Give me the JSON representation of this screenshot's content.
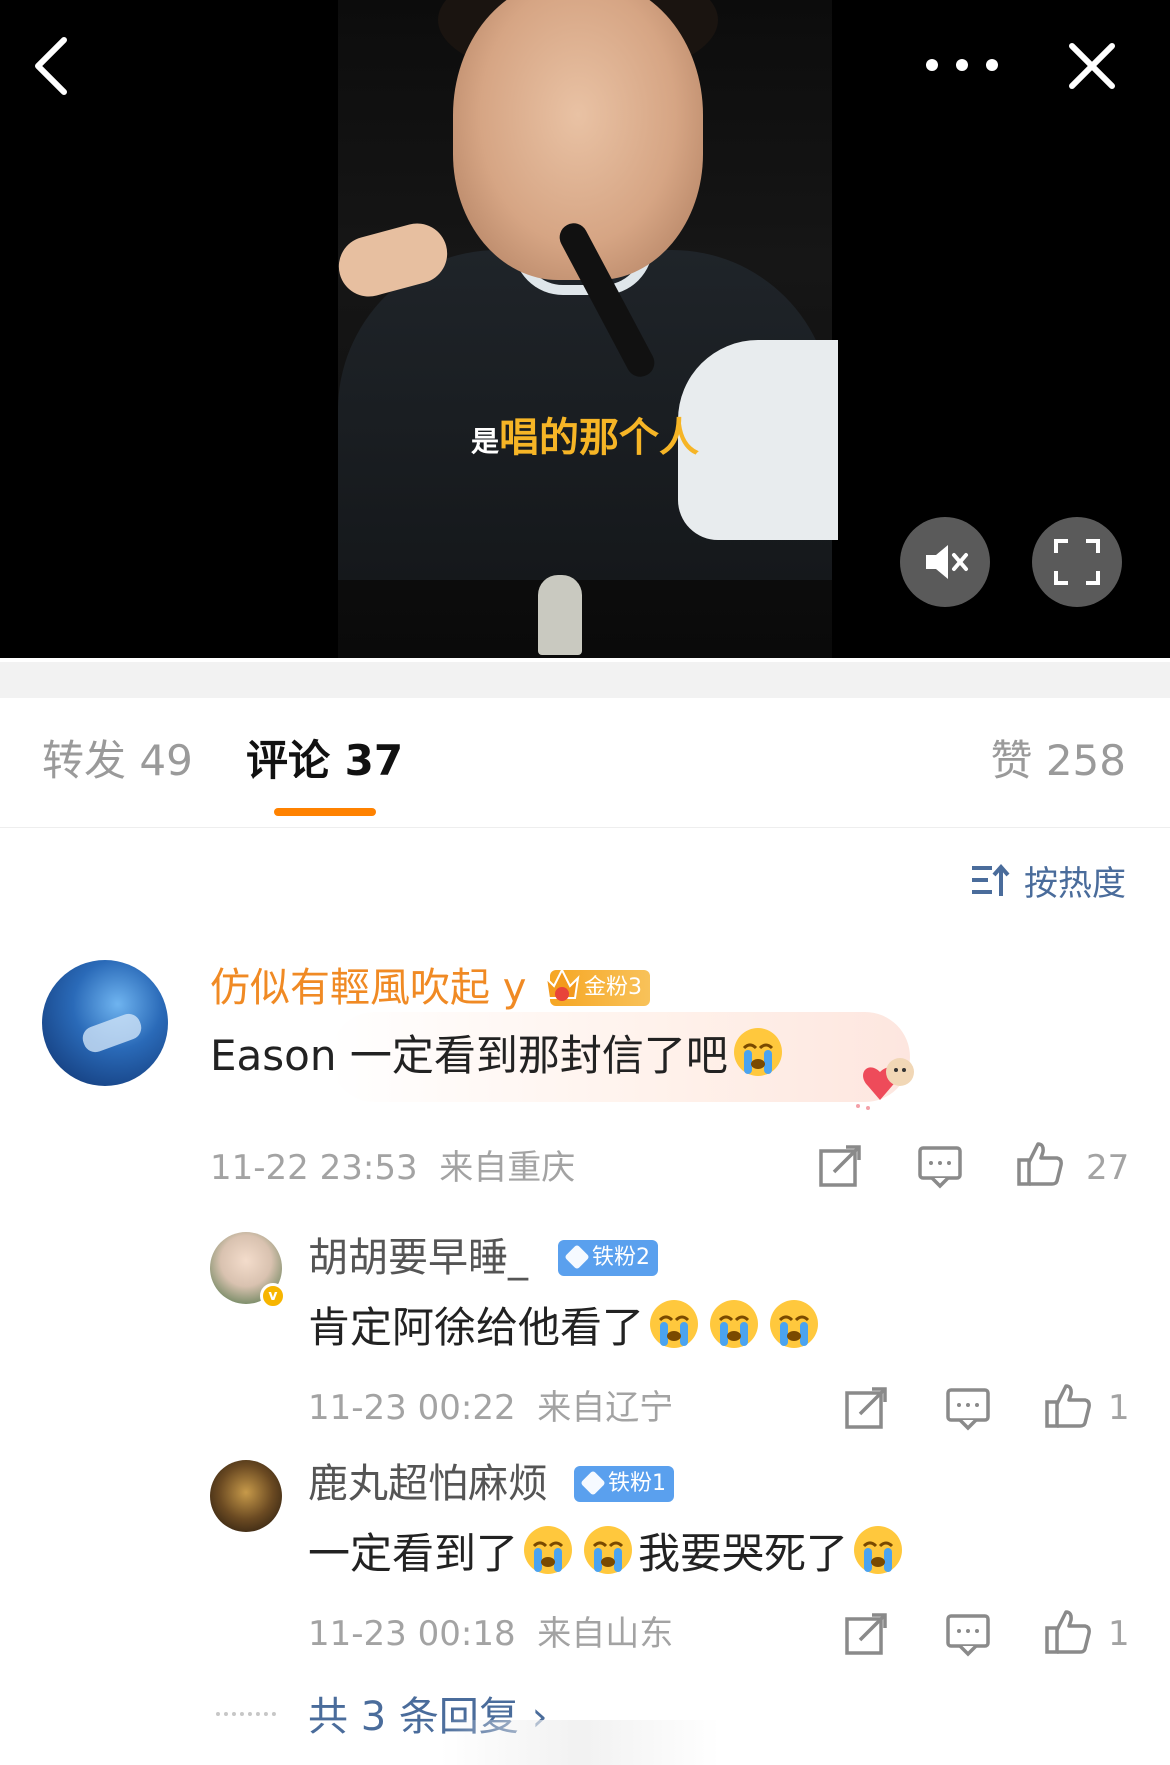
{
  "video": {
    "subtitle_small": "是",
    "subtitle_big": "唱的那个人"
  },
  "tabs": {
    "repost": "转发 49",
    "comment": "评论 37",
    "like": "赞 258"
  },
  "sort": {
    "label": "按热度"
  },
  "comments": [
    {
      "username": "仿似有輕風吹起 y",
      "badge": "金粉3",
      "text": "Eason 一定看到那封信了吧",
      "time": "11-22 23:53",
      "location": "来自重庆",
      "likes": "27"
    }
  ],
  "replies": [
    {
      "username": "胡胡要早睡_",
      "badge": "铁粉2",
      "text": "肯定阿徐给他看了",
      "time": "11-23 00:22",
      "location": "来自辽宁",
      "likes": "1",
      "verified_mark": "v"
    },
    {
      "username": "鹿丸超怕麻烦",
      "badge": "铁粉1",
      "text_part1": "一定看到了",
      "text_part2": "我要哭死了",
      "time": "11-23 00:18",
      "location": "来自山东",
      "likes": "1"
    }
  ],
  "more_replies": "共 3 条回复 ›",
  "colors": {
    "accent_orange": "#ff8200",
    "link_blue": "#4a6c9b",
    "username_orange": "#f08a24",
    "subtitle_yellow": "#f6b526"
  },
  "icons": [
    "back-icon",
    "more-icon",
    "close-icon",
    "mute-icon",
    "fullscreen-icon",
    "sort-icon",
    "share-icon",
    "comment-icon",
    "like-icon",
    "crying-emoji"
  ]
}
